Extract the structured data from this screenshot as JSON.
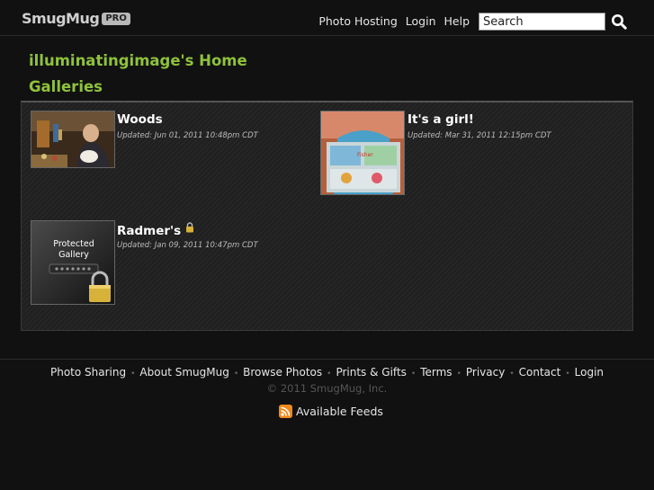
{
  "header": {
    "logo_text": "SmugMug",
    "logo_badge": "PRO",
    "nav": [
      "Photo Hosting",
      "Login",
      "Help"
    ],
    "search_placeholder": "Search"
  },
  "page": {
    "home_title": "illuminatingimage's Home",
    "galleries_title": "Galleries"
  },
  "galleries": [
    {
      "title": "Woods",
      "updated": "Updated: Jun 01, 2011 10:48pm CDT",
      "locked": false
    },
    {
      "title": "It's a girl!",
      "updated": "Updated: Mar 31, 2011 12:15pm CDT",
      "locked": false
    },
    {
      "title": "Radmer's",
      "updated": "Updated: Jan 09, 2011 10:47pm CDT",
      "locked": true,
      "thumb_text": [
        "Protected",
        "Gallery"
      ]
    }
  ],
  "footer": {
    "links": [
      "Photo Sharing",
      "About SmugMug",
      "Browse Photos",
      "Prints & Gifts",
      "Terms",
      "Privacy",
      "Contact",
      "Login"
    ],
    "copyright": "© 2011 SmugMug, Inc.",
    "feeds_label": "Available Feeds"
  },
  "colors": {
    "accent_green": "#8fc23b",
    "background": "#111111",
    "rss_orange": "#f08a1c"
  },
  "icons": [
    "search-icon",
    "lock-icon",
    "rss-icon"
  ]
}
